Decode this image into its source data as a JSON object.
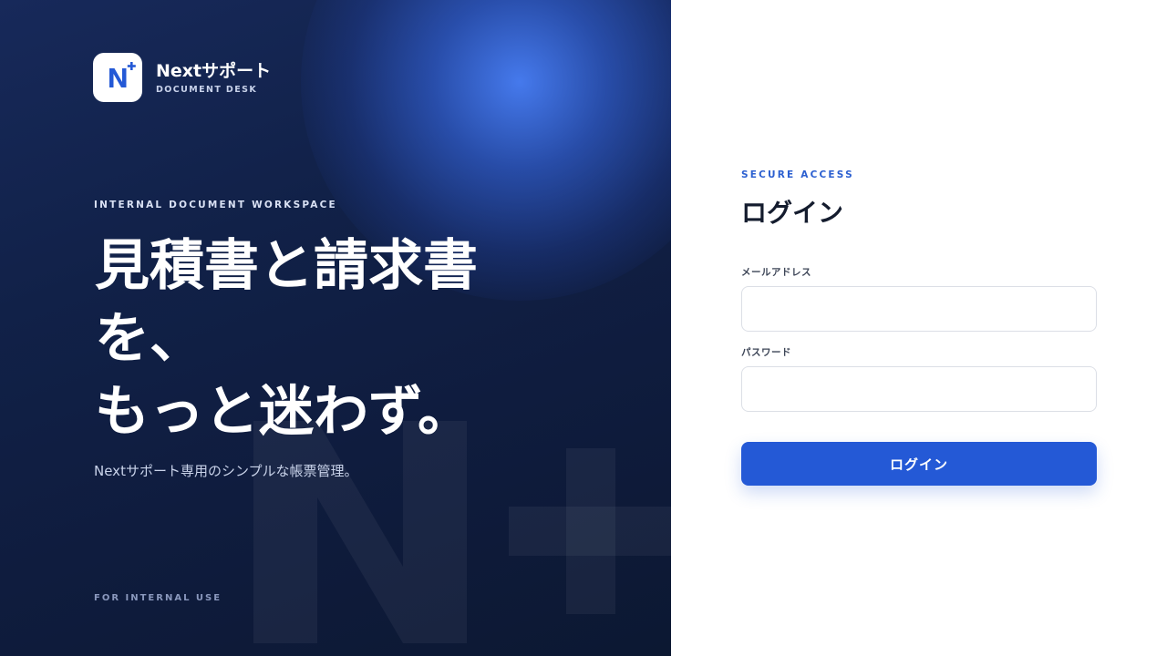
{
  "brand": {
    "logo_icon": "n-plus-logo-icon",
    "name": "Nextサポート",
    "subtitle": "DOCUMENT DESK"
  },
  "hero": {
    "eyebrow": "INTERNAL DOCUMENT WORKSPACE",
    "headline_lines": [
      "見積書と請求書",
      "を、",
      "もっと迷わず。"
    ],
    "tagline": "Nextサポート専用のシンプルな帳票管理。",
    "footer_note": "FOR INTERNAL USE",
    "watermark_icon": "n-plus-watermark-icon"
  },
  "login": {
    "eyebrow": "SECURE ACCESS",
    "title": "ログイン",
    "email_label": "メールアドレス",
    "email_value": "",
    "password_label": "パスワード",
    "password_value": "",
    "submit_label": "ログイン"
  },
  "colors": {
    "hero_background": "#112148",
    "glow": "#487ef5",
    "accent": "#2459d6",
    "eyebrow_accent": "#2b5fd0",
    "title_text": "#141c2e"
  }
}
